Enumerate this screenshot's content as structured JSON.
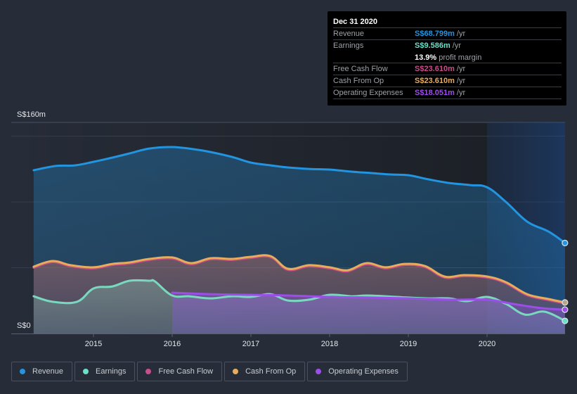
{
  "tooltip": {
    "date": "Dec 31 2020",
    "rows": [
      {
        "label": "Revenue",
        "value": "S$68.799m",
        "unit": "/yr",
        "color": "#2394df"
      },
      {
        "label": "Earnings",
        "value": "S$9.586m",
        "unit": "/yr",
        "color": "#6cdfc8"
      },
      {
        "label": "",
        "value": "13.9%",
        "unit": "profit margin",
        "color": "#ffffff"
      },
      {
        "label": "Free Cash Flow",
        "value": "S$23.610m",
        "unit": "/yr",
        "color": "#c94d8a"
      },
      {
        "label": "Cash From Op",
        "value": "S$23.610m",
        "unit": "/yr",
        "color": "#e8ad5b"
      },
      {
        "label": "Operating Expenses",
        "value": "S$18.051m",
        "unit": "/yr",
        "color": "#9c4ee8"
      }
    ]
  },
  "legend": [
    {
      "label": "Revenue",
      "color": "#2394df"
    },
    {
      "label": "Earnings",
      "color": "#6cdfc8"
    },
    {
      "label": "Free Cash Flow",
      "color": "#c94d8a"
    },
    {
      "label": "Cash From Op",
      "color": "#e8ad5b"
    },
    {
      "label": "Operating Expenses",
      "color": "#9c4ee8"
    }
  ],
  "chart_data": {
    "type": "area",
    "title": "",
    "xlabel": "",
    "ylabel": "",
    "currency_unit": "S$m",
    "y_tick_labels": [
      "S$0",
      "S$160m"
    ],
    "ylim": [
      0,
      160
    ],
    "xlim": [
      2014.24,
      2020.99
    ],
    "x_tick_labels": [
      "2015",
      "2016",
      "2017",
      "2018",
      "2019",
      "2020"
    ],
    "x_ticks": [
      2015,
      2016,
      2017,
      2018,
      2019,
      2020
    ],
    "gridlines": [
      50,
      100,
      150
    ],
    "highlight_start": 2020.0,
    "legend_position": "bottom-left",
    "series": [
      {
        "name": "Revenue",
        "color": "#2394df",
        "x": [
          2014.24,
          2014.52,
          2014.77,
          2015.0,
          2015.24,
          2015.46,
          2015.71,
          2016.0,
          2016.27,
          2016.49,
          2016.76,
          2017.0,
          2017.25,
          2017.47,
          2017.74,
          2018.0,
          2018.28,
          2018.54,
          2018.76,
          2019.0,
          2019.26,
          2019.52,
          2019.79,
          2020.0,
          2020.24,
          2020.51,
          2020.78,
          2020.99
        ],
        "values": [
          124.1,
          127.3,
          127.8,
          130.5,
          133.7,
          136.9,
          140.6,
          141.7,
          140.1,
          137.9,
          134.2,
          129.9,
          127.8,
          126.2,
          125.1,
          124.6,
          123.0,
          121.9,
          120.9,
          120.3,
          117.1,
          114.4,
          112.8,
          111.2,
          100.0,
          85.0,
          77.5,
          68.8
        ]
      },
      {
        "name": "Earnings",
        "color": "#6cdfc8",
        "x": [
          2014.24,
          2014.48,
          2014.79,
          2015.0,
          2015.24,
          2015.46,
          2015.71,
          2015.78,
          2016.0,
          2016.22,
          2016.49,
          2016.76,
          2017.0,
          2017.25,
          2017.47,
          2017.74,
          2018.0,
          2018.28,
          2018.47,
          2018.71,
          2019.0,
          2019.26,
          2019.52,
          2019.75,
          2020.0,
          2020.24,
          2020.48,
          2020.73,
          2020.99
        ],
        "values": [
          28.3,
          24.1,
          24.1,
          34.2,
          35.8,
          40.1,
          40.1,
          39.6,
          28.9,
          28.3,
          26.7,
          28.3,
          27.8,
          29.9,
          25.1,
          25.7,
          29.4,
          28.3,
          28.9,
          28.3,
          27.3,
          26.7,
          26.7,
          24.6,
          27.8,
          22.5,
          14.4,
          16.6,
          9.6
        ]
      },
      {
        "name": "Free Cash Flow",
        "color": "#c94d8a",
        "x": [
          2014.24,
          2014.48,
          2014.71,
          2015.0,
          2015.24,
          2015.46,
          2015.71,
          2016.0,
          2016.24,
          2016.49,
          2016.76,
          2017.0,
          2017.25,
          2017.47,
          2017.74,
          2018.0,
          2018.23,
          2018.47,
          2018.71,
          2018.95,
          2019.21,
          2019.46,
          2019.71,
          2020.0,
          2020.24,
          2020.51,
          2020.78,
          2020.99
        ],
        "values": [
          50.8,
          55.1,
          51.9,
          50.3,
          52.9,
          54.0,
          56.7,
          57.8,
          53.5,
          57.2,
          56.7,
          58.3,
          58.8,
          49.2,
          51.9,
          50.3,
          48.1,
          53.5,
          50.3,
          52.9,
          51.3,
          43.3,
          44.4,
          43.3,
          39.0,
          29.9,
          26.2,
          23.6
        ]
      },
      {
        "name": "Cash From Op",
        "color": "#e8ad5b",
        "x": [
          2014.24,
          2014.48,
          2014.71,
          2015.0,
          2015.24,
          2015.46,
          2015.71,
          2016.0,
          2016.24,
          2016.49,
          2016.76,
          2017.0,
          2017.25,
          2017.47,
          2017.74,
          2018.0,
          2018.23,
          2018.47,
          2018.71,
          2018.95,
          2019.21,
          2019.46,
          2019.71,
          2020.0,
          2020.24,
          2020.51,
          2020.78,
          2020.99
        ],
        "values": [
          50.8,
          55.1,
          51.9,
          50.3,
          52.9,
          54.0,
          56.7,
          57.8,
          53.5,
          57.2,
          56.7,
          58.3,
          58.8,
          49.2,
          51.9,
          50.3,
          48.1,
          53.5,
          50.3,
          52.9,
          51.3,
          43.3,
          44.4,
          43.3,
          39.0,
          29.9,
          26.2,
          23.6
        ]
      },
      {
        "name": "Operating Expenses",
        "color": "#9c4ee8",
        "x": [
          2016.0,
          2016.49,
          2017.0,
          2017.47,
          2018.0,
          2018.5,
          2019.0,
          2019.53,
          2020.0,
          2020.33,
          2020.69,
          2020.99
        ],
        "values": [
          31.0,
          29.9,
          29.4,
          28.9,
          27.8,
          27.3,
          26.7,
          25.7,
          25.7,
          22.5,
          19.3,
          18.1
        ]
      }
    ]
  }
}
